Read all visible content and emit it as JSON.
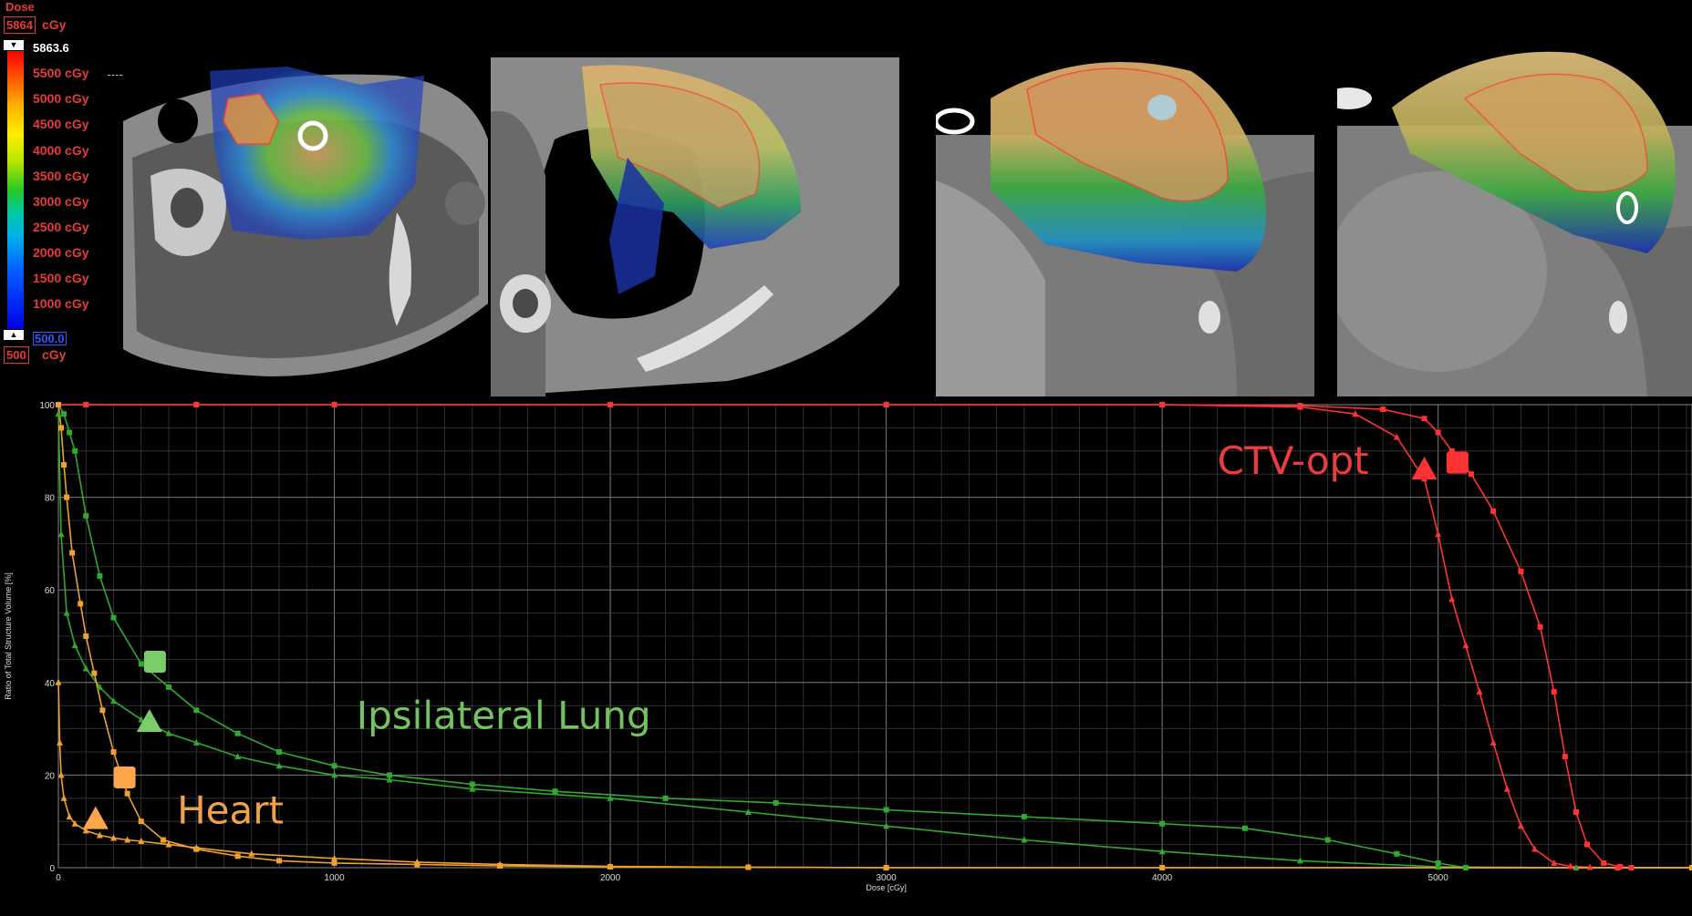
{
  "colorbar": {
    "title": "Dose",
    "max_box": "5864",
    "max_unit": "cGy",
    "max_value": "5863.6",
    "ticks": [
      "5500 cGy",
      "5000 cGy",
      "4500 cGy",
      "4000 cGy",
      "3500 cGy",
      "3000 cGy",
      "2500 cGy",
      "2000 cGy",
      "1500 cGy",
      "1000 cGy"
    ],
    "min_value": "500.0",
    "min_box": "500",
    "min_unit": "cGy"
  },
  "ct_views": [
    "axial-upper",
    "axial-chest-wall",
    "sagittal-chest-wall",
    "sagittal-breast"
  ],
  "chart_data": {
    "type": "line",
    "xlabel": "Dose [cGy]",
    "ylabel": "Ratio of Total Structure Volume [%]",
    "xlim": [
      0,
      5920
    ],
    "ylim": [
      0,
      100
    ],
    "xticks": [
      0,
      1000,
      2000,
      3000,
      4000,
      5000
    ],
    "yticks": [
      0,
      20,
      40,
      60,
      80,
      100
    ],
    "grid": true,
    "annotations": [
      {
        "text": "CTV-opt",
        "color": "#ee3b3b"
      },
      {
        "text": "Ipsilateral Lung",
        "color": "#72c35e"
      },
      {
        "text": "Heart",
        "color": "#f0a24a"
      }
    ],
    "series": [
      {
        "structure": "CTV-opt",
        "plan": "square",
        "color": "#ff3333",
        "x": [
          0,
          100,
          500,
          1000,
          2000,
          3000,
          4000,
          4500,
          4800,
          4950,
          5000,
          5050,
          5120,
          5200,
          5300,
          5370,
          5420,
          5460,
          5500,
          5540,
          5600,
          5660,
          5700,
          5920
        ],
        "y": [
          100,
          100,
          100,
          100,
          100,
          100,
          100,
          99.8,
          99,
          97,
          94,
          90,
          85,
          77,
          64,
          52,
          38,
          24,
          12,
          5,
          1,
          0.2,
          0,
          0
        ]
      },
      {
        "structure": "CTV-opt",
        "plan": "triangle",
        "color": "#ff3333",
        "x": [
          0,
          100,
          500,
          1000,
          2000,
          3000,
          4000,
          4500,
          4700,
          4850,
          4950,
          5000,
          5050,
          5100,
          5150,
          5200,
          5250,
          5300,
          5350,
          5420,
          5480,
          5550,
          5650,
          5920
        ],
        "y": [
          100,
          100,
          100,
          100,
          100,
          100,
          100,
          99.5,
          98,
          93,
          84,
          72,
          58,
          48,
          38,
          27,
          17,
          9,
          4,
          1,
          0.3,
          0.1,
          0,
          0
        ]
      },
      {
        "structure": "Ipsilateral Lung",
        "plan": "square",
        "color": "#2faa2f",
        "x": [
          0,
          20,
          40,
          60,
          100,
          150,
          200,
          300,
          400,
          500,
          650,
          800,
          1000,
          1200,
          1500,
          1800,
          2200,
          2600,
          3000,
          3500,
          4000,
          4300,
          4600,
          4850,
          5000,
          5100,
          5920
        ],
        "y": [
          100,
          98,
          94,
          90,
          76,
          63,
          54,
          44,
          39,
          34,
          29,
          25,
          22,
          20,
          18,
          16.5,
          15,
          14,
          12.5,
          11,
          9.5,
          8.5,
          6,
          3,
          1,
          0,
          0
        ]
      },
      {
        "structure": "Ipsilateral Lung",
        "plan": "triangle",
        "color": "#2faa2f",
        "x": [
          0,
          10,
          30,
          60,
          100,
          150,
          200,
          300,
          400,
          500,
          650,
          800,
          1000,
          1200,
          1500,
          2000,
          2500,
          3000,
          3500,
          4000,
          4500,
          5000,
          5500,
          5920
        ],
        "y": [
          98,
          72,
          55,
          48,
          43,
          39,
          36,
          32,
          29,
          27,
          24,
          22,
          20,
          19,
          17,
          15,
          12,
          9,
          6,
          3.5,
          1.5,
          0.2,
          0,
          0
        ]
      },
      {
        "structure": "Heart",
        "plan": "square",
        "color": "#f0a030",
        "x": [
          0,
          10,
          20,
          30,
          50,
          80,
          100,
          130,
          160,
          200,
          250,
          300,
          380,
          500,
          650,
          800,
          1000,
          1300,
          1600,
          2000,
          2500,
          3000,
          4000,
          5920
        ],
        "y": [
          100,
          95,
          87,
          80,
          68,
          57,
          50,
          42,
          34,
          25,
          16,
          10,
          6,
          4,
          2.5,
          1.5,
          1,
          0.7,
          0.4,
          0.2,
          0.1,
          0,
          0,
          0
        ]
      },
      {
        "structure": "Heart",
        "plan": "triangle",
        "color": "#f0a030",
        "x": [
          0,
          5,
          10,
          20,
          40,
          60,
          100,
          150,
          200,
          250,
          300,
          400,
          500,
          700,
          1000,
          1300,
          1600,
          2000,
          2500,
          3000,
          5920
        ],
        "y": [
          40,
          27,
          20,
          15,
          11,
          9.5,
          8,
          7,
          6.4,
          6,
          5.7,
          5,
          4.3,
          3,
          2,
          1.2,
          0.7,
          0.3,
          0.1,
          0,
          0
        ]
      }
    ]
  }
}
